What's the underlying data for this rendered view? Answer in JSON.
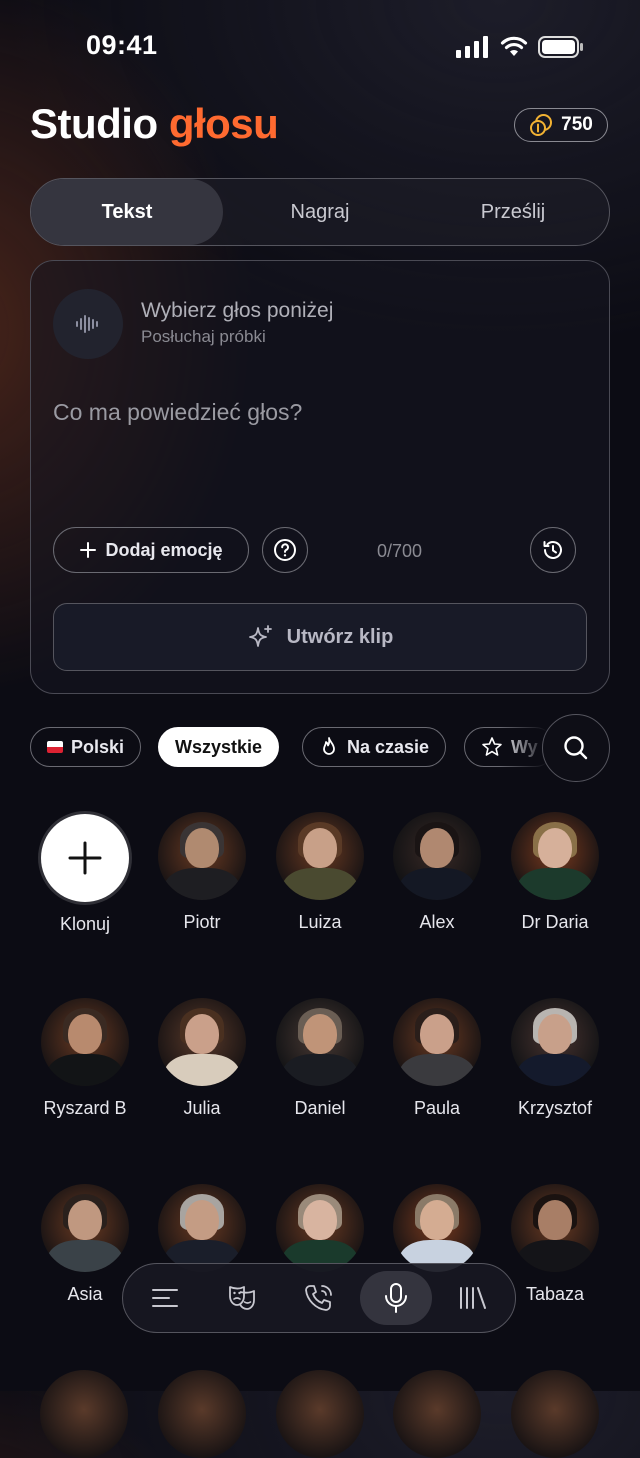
{
  "status_bar": {
    "time": "09:41"
  },
  "header": {
    "title_main": "Studio",
    "title_accent": "głosu",
    "credits": "750"
  },
  "tabs": [
    {
      "label": "Tekst",
      "active": true
    },
    {
      "label": "Nagraj",
      "active": false
    },
    {
      "label": "Prześlij",
      "active": false
    }
  ],
  "composer": {
    "voice_placeholder": "Wybierz głos poniżej",
    "voice_hint": "Posłuchaj próbki",
    "text_placeholder": "Co ma powiedzieć głos?",
    "add_emotion_label": "Dodaj emocję",
    "char_counter": "0/700",
    "create_label": "Utwórz klip"
  },
  "filters": [
    {
      "label": "Polski",
      "icon": "poland-flag-icon",
      "selected": false
    },
    {
      "label": "Wszystkie",
      "selected": true
    },
    {
      "label": "Na czasie",
      "icon": "flame-icon",
      "selected": false
    },
    {
      "label": "Wy",
      "icon": "star-icon",
      "selected": false
    }
  ],
  "voices": [
    {
      "name": "Klonuj",
      "type": "clone"
    },
    {
      "name": "Piotr"
    },
    {
      "name": "Luiza"
    },
    {
      "name": "Alex"
    },
    {
      "name": "Dr Daria"
    },
    {
      "name": "Ryszard B"
    },
    {
      "name": "Julia"
    },
    {
      "name": "Daniel"
    },
    {
      "name": "Paula"
    },
    {
      "name": "Krzysztof"
    },
    {
      "name": "Asia"
    },
    {
      "name": ""
    },
    {
      "name": ""
    },
    {
      "name": ""
    },
    {
      "name": "Tabaza"
    }
  ],
  "bottom_nav": [
    {
      "icon": "menu-icon",
      "active": false
    },
    {
      "icon": "theater-masks-icon",
      "active": false
    },
    {
      "icon": "phone-call-icon",
      "active": false
    },
    {
      "icon": "microphone-icon",
      "active": true
    },
    {
      "icon": "library-icon",
      "active": false
    }
  ],
  "colors": {
    "accent": "#ff6a30",
    "background": "#0c0c14",
    "coin": "#f2b233"
  }
}
